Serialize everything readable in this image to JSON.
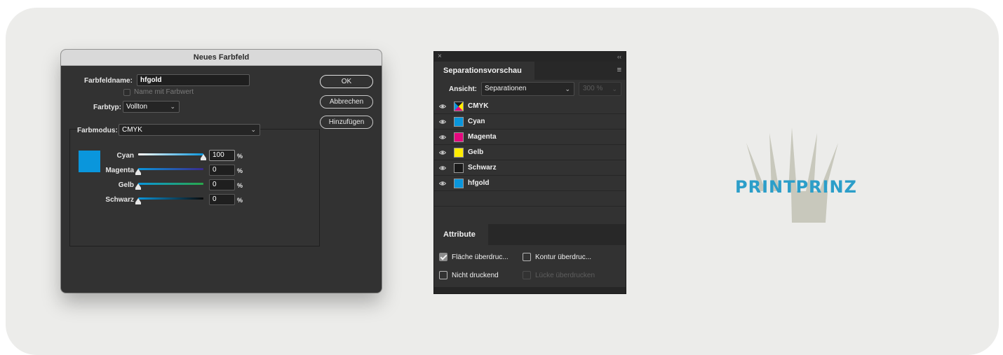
{
  "dialog": {
    "title": "Neues Farbfeld",
    "swatch_name_label": "Farbfeldname:",
    "swatch_name_value": "hfgold",
    "name_with_value_label": "Name mit Farbwert",
    "color_type_label": "Farbtyp:",
    "color_type_value": "Vollton",
    "color_mode_label": "Farbmodus:",
    "color_mode_value": "CMYK",
    "buttons": {
      "ok": "OK",
      "cancel": "Abbrechen",
      "add": "Hinzufügen"
    },
    "preview_color": "#0a96dc",
    "sliders": [
      {
        "label": "Cyan",
        "value": "100",
        "unit": "%",
        "level": 1.0
      },
      {
        "label": "Magenta",
        "value": "0",
        "unit": "%",
        "level": 0.0
      },
      {
        "label": "Gelb",
        "value": "0",
        "unit": "%",
        "level": 0.0
      },
      {
        "label": "Schwarz",
        "value": "0",
        "unit": "%",
        "level": 0.0
      }
    ]
  },
  "separations": {
    "close_icon": "×",
    "collapse_icon": "‹‹",
    "tab_label": "Separationsvorschau",
    "view_label": "Ansicht:",
    "view_value": "Separationen",
    "zoom_value": "300 %",
    "rows": [
      {
        "name": "CMYK",
        "color": "cmyk"
      },
      {
        "name": "Cyan",
        "color": "#0a96dc"
      },
      {
        "name": "Magenta",
        "color": "#e4087e"
      },
      {
        "name": "Gelb",
        "color": "#ffec00"
      },
      {
        "name": "Schwarz",
        "color": "#1a1a1a"
      },
      {
        "name": "hfgold",
        "color": "#0a96dc"
      }
    ],
    "attributes_tab": "Attribute",
    "attributes": {
      "overprint_fill": "Fläche überdruc...",
      "overprint_stroke": "Kontur überdruc...",
      "nonprinting": "Nicht druckend",
      "overprint_gap": "Lücke überdrucken"
    }
  },
  "logo": {
    "text": "PRINTPRINZ",
    "text_color": "#2c9ec9",
    "crown_color": "#c8c8bc"
  }
}
